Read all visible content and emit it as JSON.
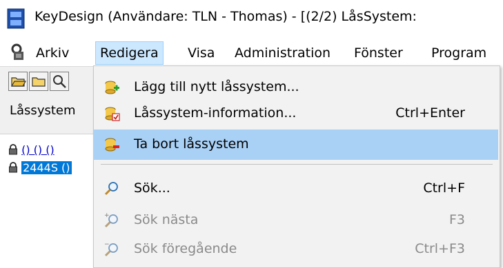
{
  "titlebar": {
    "title": "KeyDesign   (Användare: TLN - Thomas) - [(2/2) LåsSystem:"
  },
  "menubar": {
    "items": [
      {
        "label": "Arkiv"
      },
      {
        "label": "Redigera"
      },
      {
        "label": "Visa"
      },
      {
        "label": "Administration"
      },
      {
        "label": "Fönster"
      },
      {
        "label": "Program"
      }
    ]
  },
  "header": {
    "label": "Låssystem"
  },
  "tree": {
    "rows": [
      {
        "label": "() () ()"
      },
      {
        "label": "2444S ()"
      }
    ]
  },
  "dropdown": {
    "items": [
      {
        "label": "Lägg till nytt låssystem...",
        "shortcut": ""
      },
      {
        "label": "Låssystem-information...",
        "shortcut": "Ctrl+Enter"
      },
      {
        "label": "Ta bort låssystem",
        "shortcut": ""
      },
      {
        "label": "Sök...",
        "shortcut": "Ctrl+F"
      },
      {
        "label": "Sök nästa",
        "shortcut": "F3"
      },
      {
        "label": "Sök föregående",
        "shortcut": "Ctrl+F3"
      }
    ]
  },
  "colors": {
    "highlight": "#a9d0f5",
    "menu_active": "#cce8ff",
    "selection": "#0078d7"
  }
}
